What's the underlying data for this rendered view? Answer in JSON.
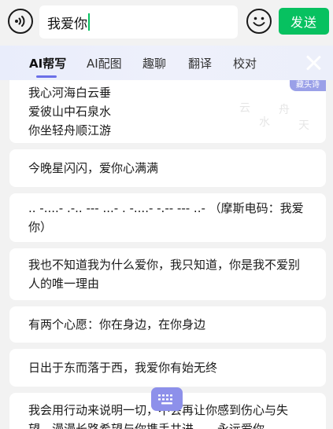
{
  "input": {
    "value": "我爱你"
  },
  "send_label": "发送",
  "tabs": [
    {
      "label": "AI帮写",
      "active": true
    },
    {
      "label": "AI配图",
      "active": false
    },
    {
      "label": "趣聊",
      "active": false
    },
    {
      "label": "翻译",
      "active": false
    },
    {
      "label": "校对",
      "active": false
    }
  ],
  "suggestions": [
    {
      "text": "我心河海白云垂\n爱彼山中石泉水\n你坐轻舟顺江游",
      "badge": "藏头诗"
    },
    {
      "text": "今晚星闪闪，爱你心满满"
    },
    {
      "text": ".. -....- .-.. --- ...- . -....- -.-- --- ..- （摩斯电码：我爱你）"
    },
    {
      "text": "我也不知道我为什么爱你，我只知道，你是我不爱别人的唯一理由"
    },
    {
      "text": "有两个心愿：你在身边，在你身边"
    },
    {
      "text": "日出于东而落于西，我爱你有始无终"
    },
    {
      "text": "我会用行动来说明一切，不会再让你感到伤心与失望。漫漫长路希望与你携手共进——永远爱你"
    }
  ],
  "colors": {
    "accent_green": "#07c160",
    "tab_accent": "#6a6fe8"
  }
}
